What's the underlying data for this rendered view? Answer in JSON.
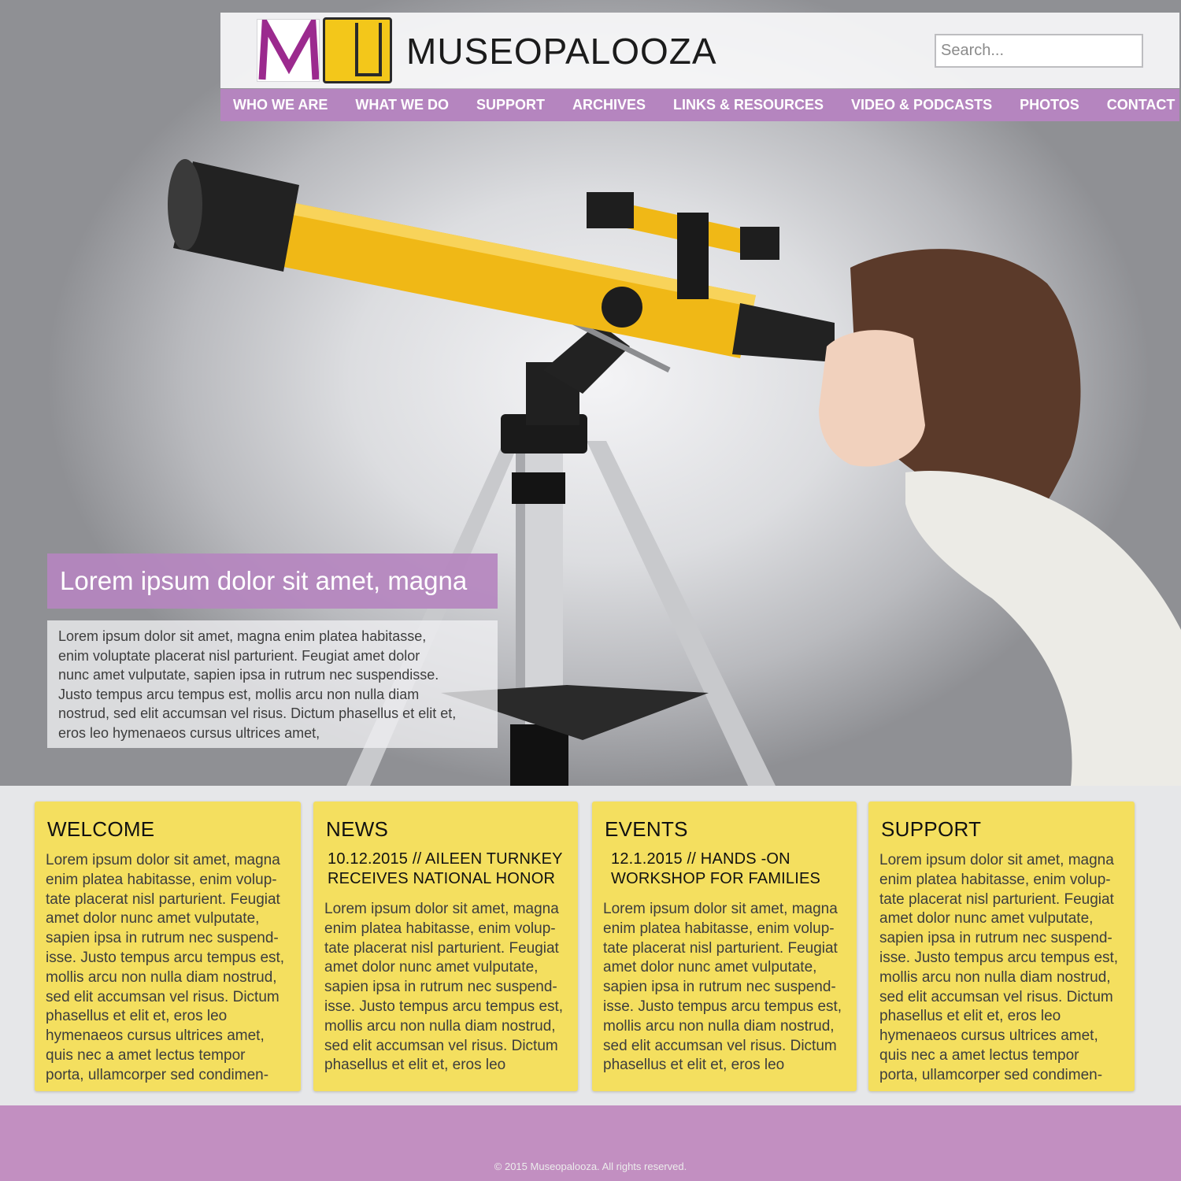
{
  "header": {
    "brand": "MUSEOPALOOZA",
    "search_placeholder": "Search..."
  },
  "nav": {
    "items": [
      "WHO WE ARE",
      "WHAT WE DO",
      "SUPPORT",
      "ARCHIVES",
      "LINKS & RESOURCES",
      "VIDEO & PODCASTS",
      "PHOTOS",
      "CONTACT"
    ]
  },
  "hero": {
    "title": "Lorem ipsum dolor sit amet, magna",
    "body": "Lorem ipsum dolor sit amet, magna enim platea habitasse,\n enim voluptate placerat nisl parturient. Feugiat amet dolor\nnunc amet vulputate, sapien ipsa in rutrum nec suspendisse.\nJusto tempus arcu tempus est, mollis arcu non nulla diam\nnostrud, sed elit accumsan vel risus. Dictum phasellus et elit et,\neros leo hymenaeos cursus ultrices amet,"
  },
  "cards": {
    "welcome": {
      "heading": "WELCOME",
      "body": "Lorem ipsum dolor sit amet, magna\nenim platea habitasse, enim volup-\ntate placerat nisl parturient. Feugiat\namet dolor nunc amet vulputate,\nsapien ipsa in rutrum nec suspend-\nisse. Justo tempus arcu tempus est,\nmollis arcu non nulla diam nostrud,\nsed elit accumsan vel risus. Dictum\nphasellus et elit et, eros leo\nhymenaeos cursus ultrices amet,\nquis nec a amet lectus tempor\nporta, ullamcorper sed condimen-"
    },
    "news": {
      "heading": "NEWS",
      "subheading": "10.12.2015 // AILEEN TURNKEY RECEIVES NATIONAL HONOR",
      "body": "Lorem ipsum dolor sit amet, magna\nenim platea habitasse, enim volup-\ntate placerat nisl parturient. Feugiat\namet dolor nunc amet vulputate,\nsapien ipsa in rutrum nec suspend-\nisse. Justo tempus arcu tempus est,\nmollis arcu non nulla diam nostrud,\nsed elit accumsan vel risus. Dictum\nphasellus et elit et, eros leo"
    },
    "events": {
      "heading": "EVENTS",
      "subheading": "12.1.2015 // HANDS -ON WORKSHOP FOR FAMILIES",
      "body": "Lorem ipsum dolor sit amet, magna\nenim platea habitasse, enim volup-\ntate placerat nisl parturient. Feugiat\namet dolor nunc amet vulputate,\nsapien ipsa in rutrum nec suspend-\nisse. Justo tempus arcu tempus est,\nmollis arcu non nulla diam nostrud,\nsed elit accumsan vel risus. Dictum\nphasellus et elit et, eros leo"
    },
    "support": {
      "heading": "SUPPORT",
      "body": "Lorem ipsum dolor sit amet, magna\nenim platea habitasse, enim volup-\ntate placerat nisl parturient. Feugiat\namet dolor nunc amet vulputate,\nsapien ipsa in rutrum nec suspend-\nisse. Justo tempus arcu tempus est,\nmollis arcu non nulla diam nostrud,\nsed elit accumsan vel risus. Dictum\nphasellus et elit et, eros leo\nhymenaeos cursus ultrices amet,\nquis nec a amet lectus tempor\nporta, ullamcorper sed condimen-"
    }
  },
  "footer": {
    "copyright": "© 2015 Museopalooza. All rights reserved."
  },
  "colors": {
    "accent_purple": "#b585bf",
    "footer_purple": "#c28fc1",
    "card_yellow": "#f4df5f",
    "logo_yellow": "#f3c71a",
    "logo_magenta": "#9b2a8e"
  }
}
